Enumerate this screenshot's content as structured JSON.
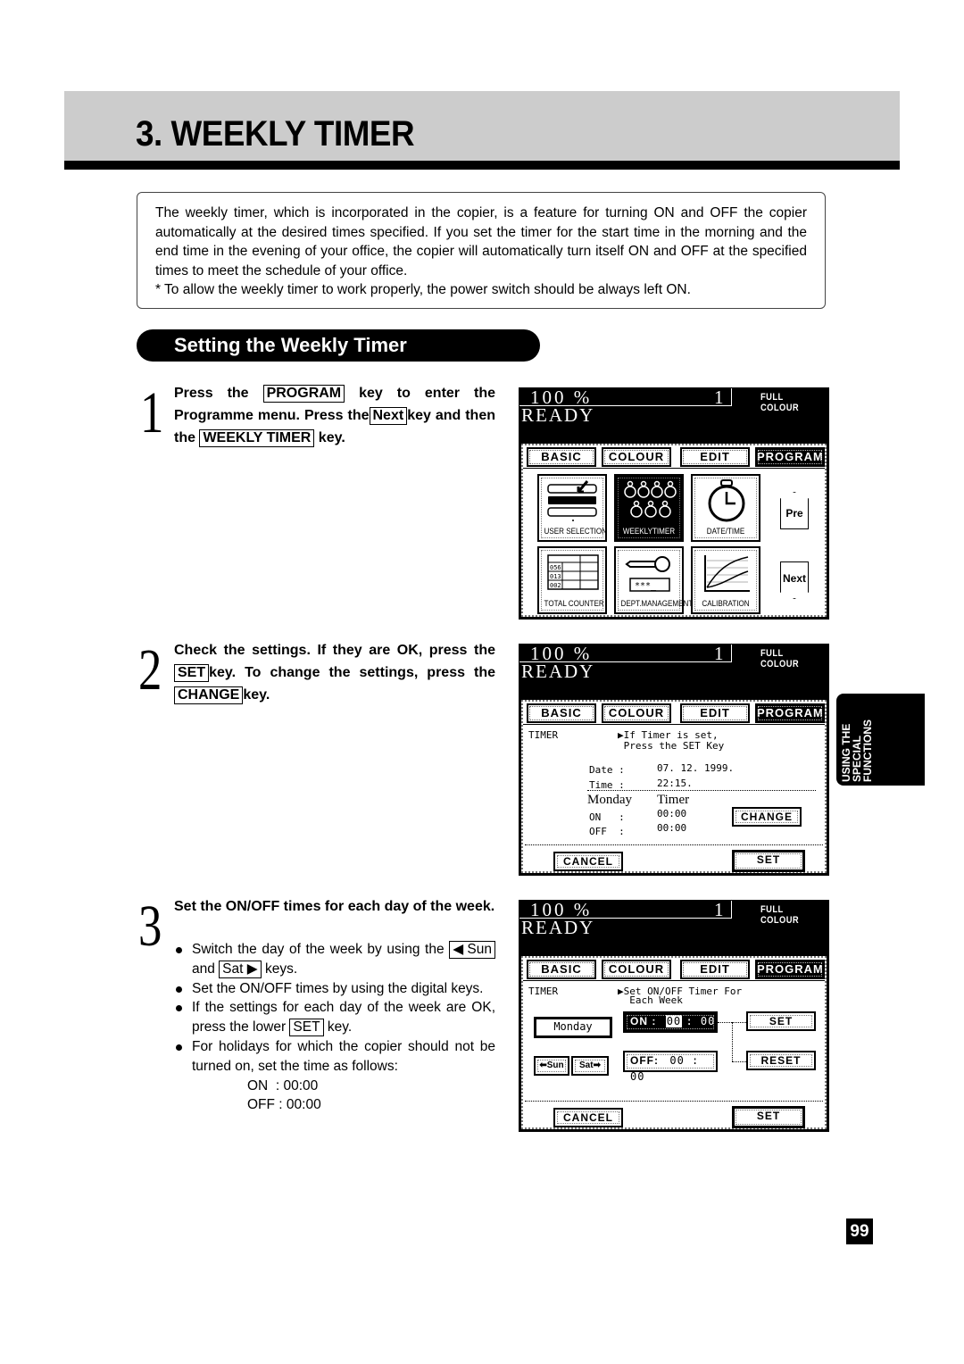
{
  "page": {
    "title": "3.  WEEKLY TIMER",
    "page_number": "99",
    "side_tab": [
      "USING THE",
      "SPECIAL",
      "FUNCTIONS"
    ]
  },
  "intro": {
    "paragraph": "The weekly timer, which is incorporated in the copier, is a feature for turning ON and OFF the copier automatically at the desired times specified.  If you set the timer for the start time in the morning and the end time in the evening of your office, the copier will automatically turn itself ON and OFF at the specified times to meet the schedule of your office.",
    "note": "* To allow the weekly timer to work properly, the power switch should be always left ON."
  },
  "section": {
    "title": "Setting the Weekly Timer"
  },
  "steps": [
    {
      "number": "1",
      "parts": [
        "Press the ",
        "PROGRAM",
        " key to enter the Programme menu. Press the",
        "Next",
        "key and then the ",
        "WEEKLY TIMER",
        " key."
      ]
    },
    {
      "number": "2",
      "parts": [
        "Check the settings. If they are OK, press the",
        "SET",
        "key. To change the settings, press the ",
        "CHANGE",
        "key."
      ]
    },
    {
      "number": "3",
      "title": "Set the ON/OFF times for each day of the week.",
      "bullets": [
        {
          "parts": [
            "Switch the day of the week by using the ",
            "◀ Sun",
            " and ",
            "Sat ▶",
            "  keys."
          ]
        },
        {
          "text": "Set the ON/OFF times by using the digital keys."
        },
        {
          "parts": [
            "If the settings for each day of the week are OK, press the lower ",
            "SET",
            " key."
          ]
        },
        {
          "text": "For holidays for which the copier should not be turned on, set the time as follows:",
          "times": [
            "ON  : 00:00",
            "OFF : 00:00"
          ]
        }
      ]
    }
  ],
  "screen_common": {
    "zoom": "100 %",
    "count": "1",
    "mode": "FULL COLOUR",
    "status": "READY",
    "tabs": [
      "BASIC",
      "COLOUR",
      "EDIT",
      "PROGRAM"
    ],
    "active_tab": "PROGRAM"
  },
  "screen1": {
    "icons": [
      "USER SELECTION",
      "WEEKLYTIMER",
      "DATE/TIME",
      "TOTAL COUNTER",
      "DEPT.MANAGEMENT",
      "CALIBRATION"
    ],
    "selected_icon": "WEEKLYTIMER",
    "pre_label": "Pre",
    "next_label": "Next",
    "counter_rows": [
      "056",
      "013",
      "002"
    ],
    "password_mask": "***_"
  },
  "screen2": {
    "heading": "TIMER",
    "prompt_line1": "▶If Timer is set,",
    "prompt_line2": " Press the SET Key",
    "date_label": "Date :",
    "date_value": "07. 12. 1999.",
    "time_label": "Time :",
    "time_value": "22:15.",
    "day": "Monday",
    "timer_label": "Timer",
    "on_label": "ON   :",
    "on_value": "00:00",
    "off_label": "OFF  :",
    "off_value": "00:00",
    "change_button": "CHANGE",
    "cancel_button": "CANCEL",
    "set_button": "SET"
  },
  "screen3": {
    "heading": "TIMER",
    "prompt_line1": "▶Set ON/OFF Timer For",
    "prompt_line2": "  Each Week",
    "day": "Monday",
    "prev_day_button": "⬅Sun",
    "next_day_button": "Sat➡",
    "on_label": "ON :",
    "on_hours": "00",
    "on_minutes": ": 00",
    "off_label": "OFF:",
    "off_value": "00 : 00",
    "set_button": "SET",
    "reset_button": "RESET",
    "cancel_button": "CANCEL",
    "lower_set_button": "SET"
  }
}
